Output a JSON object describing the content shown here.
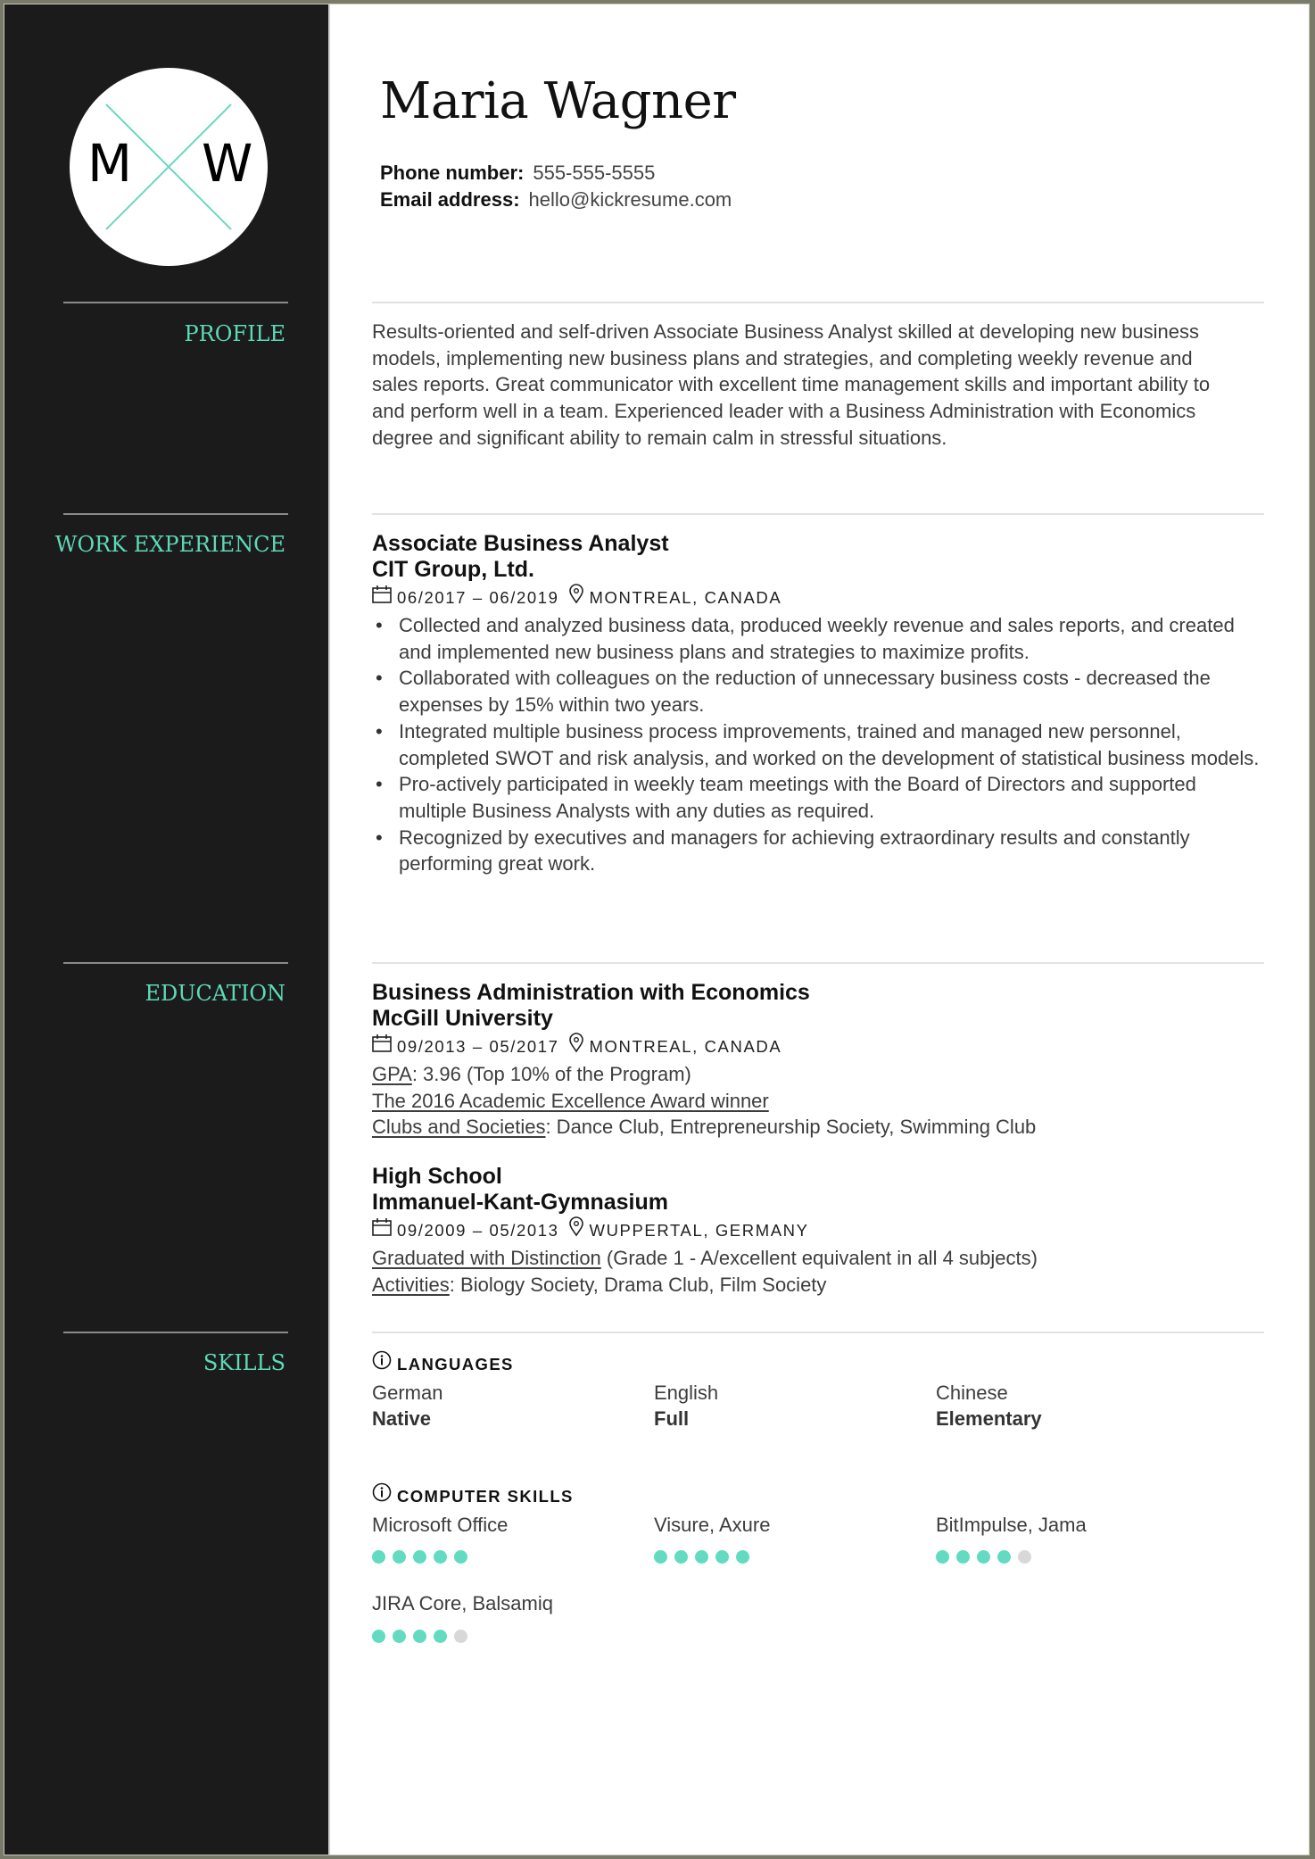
{
  "colors": {
    "accent": "#5dd9b6",
    "sidebar_bg": "#1b1b1b",
    "dot_on": "#62dbc0",
    "dot_off": "#d8d8d8"
  },
  "avatar": {
    "initial_left": "M",
    "initial_right": "W"
  },
  "header": {
    "name": "Maria Wagner",
    "phone_label": "Phone number:",
    "phone": "555-555-5555",
    "email_label": "Email address:",
    "email": "hello@kickresume.com"
  },
  "sections": {
    "profile": "PROFILE",
    "work": "WORK EXPERIENCE",
    "education": "EDUCATION",
    "skills": "SKILLS"
  },
  "profile": {
    "text": "Results-oriented and self-driven Associate Business Analyst skilled at developing new business models, implementing new business plans and strategies, and completing weekly revenue and sales reports. Great communicator with excellent time management skills and important ability to and perform well in a team. Experienced leader with a Business Administration with Economics degree and significant ability to remain calm in stressful situations."
  },
  "work": [
    {
      "title": "Associate Business Analyst",
      "company": "CIT Group, Ltd.",
      "dates": "06/2017 – 06/2019",
      "location": "MONTREAL, CANADA",
      "bullets": [
        "Collected and analyzed business data, produced weekly revenue and sales reports, and created and implemented new business plans and strategies to maximize profits.",
        "Collaborated with colleagues on the reduction of unnecessary business costs - decreased the expenses by 15% within two years.",
        "Integrated multiple business process improvements, trained and managed new personnel, completed SWOT and risk analysis, and worked on the development of statistical business models.",
        "Pro-actively participated in weekly team meetings with the Board of Directors and supported multiple Business Analysts with any duties as required.",
        "Recognized by executives and managers for achieving extraordinary results and constantly performing great work."
      ]
    }
  ],
  "education": [
    {
      "degree": "Business Administration with Economics",
      "school": "McGill University",
      "dates": "09/2013 – 05/2017",
      "location": "MONTREAL, CANADA",
      "gpa_label": "GPA",
      "gpa_text": ": 3.96 (Top 10% of the Program)",
      "award": "The 2016 Academic Excellence Award winner",
      "clubs_label": "Clubs and Societies",
      "clubs_text": ": Dance Club, Entrepreneurship Society, Swimming Club"
    },
    {
      "degree": "High School",
      "school": "Immanuel-Kant-Gymnasium",
      "dates": "09/2009 – 05/2013",
      "location": "WUPPERTAL, GERMANY",
      "distinction_label": "Graduated with Distinction",
      "distinction_text": " (Grade 1 - A/excellent equivalent in all 4 subjects)",
      "activities_label": "Activities",
      "activities_text": ": Biology Society, Drama Club, Film Society"
    }
  ],
  "skills": {
    "languages_title": "LANGUAGES",
    "languages": [
      {
        "name": "German",
        "level": "Native"
      },
      {
        "name": "English",
        "level": "Full"
      },
      {
        "name": "Chinese",
        "level": "Elementary"
      }
    ],
    "computer_title": "COMPUTER SKILLS",
    "computer": [
      {
        "name": "Microsoft Office",
        "rating": 5,
        "max": 5
      },
      {
        "name": "Visure, Axure",
        "rating": 5,
        "max": 5
      },
      {
        "name": "BitImpulse, Jama",
        "rating": 4,
        "max": 5
      },
      {
        "name": "JIRA Core, Balsamiq",
        "rating": 4,
        "max": 5
      }
    ]
  }
}
